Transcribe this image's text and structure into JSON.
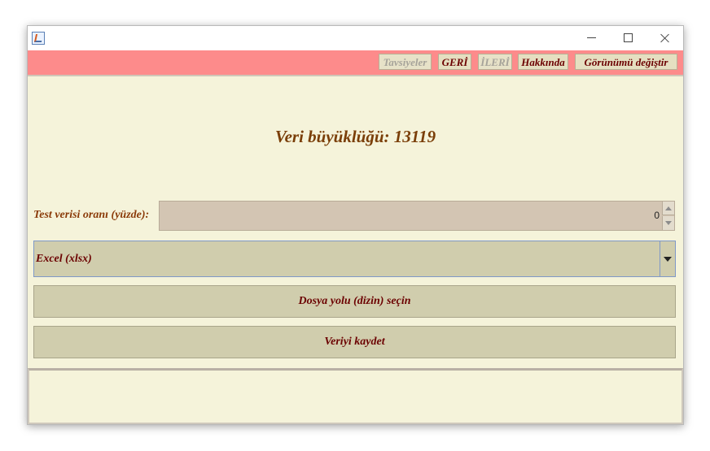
{
  "toolbar": {
    "recommendations": "Tavsiyeler",
    "back": "GERİ",
    "forward": "İLERİ",
    "about": "Hakkında",
    "change_view": "Görünümü değiştir"
  },
  "main": {
    "heading": "Veri büyüklüğü: 13119",
    "test_ratio_label": "Test verisi oranı (yüzde):",
    "test_ratio_value": "0",
    "format_selected": "Excel (xlsx)",
    "select_path_button": "Dosya yolu (dizin) seçin",
    "save_button": "Veriyi kaydet"
  },
  "colors": {
    "toolbar_bg": "#fd8b8b",
    "panel_bg": "#f5f3da",
    "button_bg": "#d0cdad",
    "text_dark_red": "#6b0000",
    "heading_brown": "#7a3e08"
  },
  "icons": [
    "app-icon",
    "minimize-icon",
    "maximize-icon",
    "close-icon",
    "spinner-up-icon",
    "spinner-down-icon",
    "dropdown-arrow-icon"
  ]
}
